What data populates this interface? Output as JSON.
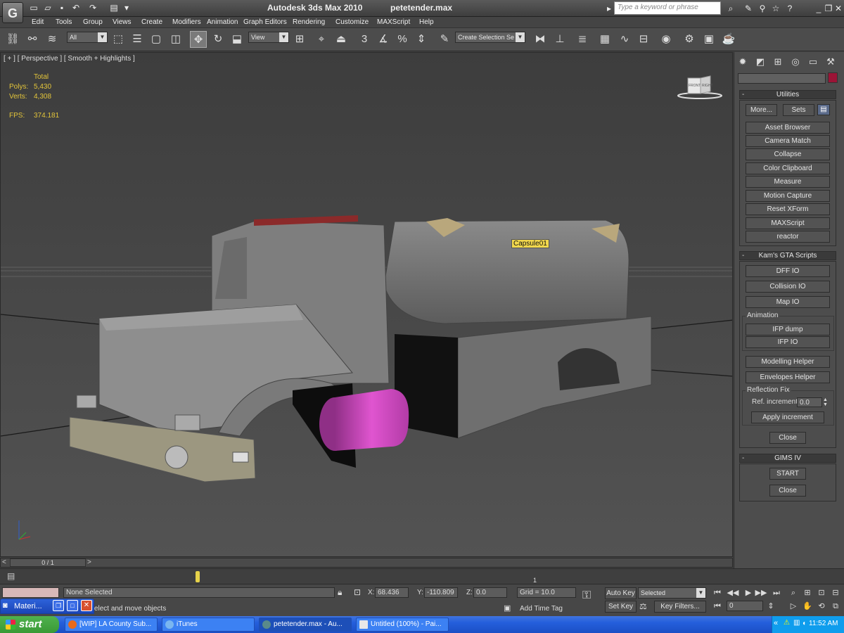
{
  "title_bar": {
    "app_title": "Autodesk 3ds Max  2010",
    "file_name": "petetender.max",
    "search_placeholder": "Type a keyword or phrase"
  },
  "menu": {
    "items": [
      "Edit",
      "Tools",
      "Group",
      "Views",
      "Create",
      "Modifiers",
      "Animation",
      "Graph Editors",
      "Rendering",
      "Customize",
      "MAXScript",
      "Help"
    ]
  },
  "toolbar": {
    "selection_filter": "All",
    "ref_coord": "View",
    "snap_label": "3",
    "named_selection": "Create Selection Se"
  },
  "viewport": {
    "label": "[ + ] [ Perspective ] [ Smooth + Highlights ]",
    "stats_header": "Total",
    "polys_label": "Polys:",
    "polys_value": "5,430",
    "verts_label": "Verts:",
    "verts_value": "4,308",
    "fps_label": "FPS:",
    "fps_value": "374.181",
    "object_label": "Capsule01",
    "viewcube_front": "FRONT",
    "viewcube_right": "RIGHT"
  },
  "command_panel": {
    "utilities_title": "Utilities",
    "more_button": "More...",
    "sets_button": "Sets",
    "utility_buttons": [
      "Asset Browser",
      "Camera Match",
      "Collapse",
      "Color Clipboard",
      "Measure",
      "Motion Capture",
      "Reset XForm",
      "MAXScript",
      "reactor"
    ],
    "gta_title": "Kam's GTA Scripts",
    "gta_buttons": [
      "DFF IO",
      "Collision IO",
      "Map IO"
    ],
    "animation_group": "Animation",
    "animation_buttons": [
      "IFP dump",
      "IFP IO"
    ],
    "helper_buttons": [
      "Modelling Helper",
      "Envelopes Helper"
    ],
    "reflection_group": "Reflection Fix",
    "ref_increment_label": "Ref. increment",
    "ref_increment_value": "0.0",
    "apply_increment": "Apply increment",
    "close_button": "Close",
    "gims_title": "GIMS IV",
    "gims_start": "START",
    "gims_close": "Close"
  },
  "timeline": {
    "frame_counter": "0 / 1",
    "track_tick": "1"
  },
  "status": {
    "selection": "None Selected",
    "prompt": "drag to select and move objects",
    "x_label": "X:",
    "x_value": "68.436",
    "y_label": "Y:",
    "y_value": "-110.809",
    "z_label": "Z:",
    "z_value": "0.0",
    "grid": "Grid = 10.0",
    "add_time_tag": "Add Time Tag",
    "auto_key": "Auto Key",
    "selected_dropdown": "Selected",
    "set_key": "Set Key",
    "key_filters": "Key Filters...",
    "frame_field": "0"
  },
  "mini_window": {
    "label": "Materi..."
  },
  "taskbar": {
    "start": "start",
    "tasks": [
      "[WIP] LA County Sub...",
      "iTunes",
      "petetender.max - Au...",
      "Untitled (100%) - Pai..."
    ],
    "clock": "11:52 AM"
  },
  "colors": {
    "viewport_bg": "#4d4d4d",
    "capsule_magenta": "#cc44b8",
    "label_yellow": "#f2d84d",
    "stats_yellow": "#e3c53a",
    "swatch_red": "#9b1436",
    "taskbar_blue": "#245edb",
    "start_green": "#3a9a36"
  }
}
